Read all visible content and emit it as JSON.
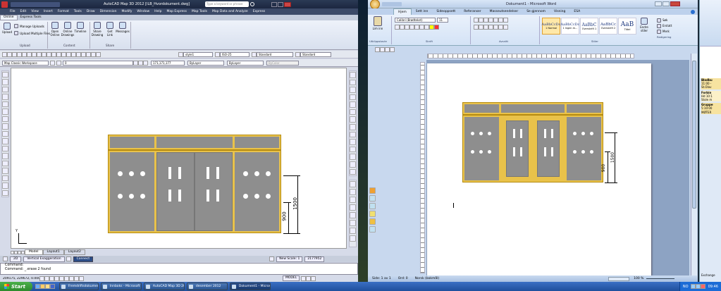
{
  "acad": {
    "title": "AutoCAD Map 3D 2012   [ILB_Hvordokument.dwg]",
    "search_placeholder": "Type a keyword or phrase",
    "menu": [
      "File",
      "Edit",
      "View",
      "Insert",
      "Format",
      "Tools",
      "Draw",
      "Dimension",
      "Modify",
      "Window",
      "Help",
      "Map Express",
      "Map Tools",
      "Map Data and Analyze",
      "Express"
    ],
    "ribbon_tabs": [
      "Online",
      "Express Tools"
    ],
    "upload_panel": {
      "upload": "Upload",
      "manage": "Manage Uploads",
      "multiple": "Upload Multiple Files",
      "label": "Upload"
    },
    "content_panel": {
      "open": "Open Online",
      "drawings": "Online Drawings",
      "timeline": "Timeline",
      "label": "Content"
    },
    "share_panel": {
      "share": "Share Drawing",
      "get_link": "Get Link",
      "messages": "Messages",
      "label": "Share"
    },
    "style_box": "style1",
    "dim_box": "ISO-25",
    "table_box": "Standard",
    "mleader_box": "Standard",
    "workspace": "Map Classic Workspace",
    "layer": "0",
    "color": "171,171,177",
    "linetype": "ByLayer",
    "lineweight": "ByLayer",
    "plotstyle": "ByColor",
    "dim_900": "900",
    "dim_1500": "1500",
    "layout_tabs": [
      "Model",
      "Layout1",
      "Layout2"
    ],
    "status_items": [
      "2D",
      "Vertical Exaggeration",
      "Connect"
    ],
    "status_right": [
      "New Scale: 1",
      "2177952",
      "MODEL"
    ],
    "cmd_lines": [
      "Command:",
      "Command:  _.erase 2 found"
    ],
    "coords": "209175, 229672, 0.0000",
    "axis_y": "Y"
  },
  "word": {
    "title": "Dokument1 - Microsoft Word",
    "tabs": [
      "Hjem",
      "Sett inn",
      "Sideoppsett",
      "Referanser",
      "Masseutsendelser",
      "Se gjennom",
      "Visning",
      "ESA"
    ],
    "clipboard": {
      "paste": "Lim inn",
      "label": "Utklippstavle"
    },
    "font_name": "Calibri (Brødtekst)",
    "font_size": "11",
    "font_label": "Skrift",
    "para_label": "Avsnitt",
    "styles_label": "Stiler",
    "edit_label": "Redigering",
    "styles": [
      {
        "sample": "AaBbCcDc",
        "name": "1 Normal"
      },
      {
        "sample": "AaBbCcDc",
        "name": "1 Ingen m..."
      },
      {
        "sample": "AaBbC",
        "name": "Overskrift 1"
      },
      {
        "sample": "AaBbCc",
        "name": "Overskrift 2"
      },
      {
        "sample": "AaB",
        "name": "Tittel"
      }
    ],
    "change_styles": "Endre stiler",
    "edit_items": [
      "Søk",
      "Erstatt",
      "Merk"
    ],
    "dim_900": "900",
    "dim_1500": "1500",
    "status": [
      "Side: 1 av 1",
      "Ord: 0",
      "Norsk (bokmål)"
    ],
    "zoom": "100 %"
  },
  "right_strip": {
    "items": [
      "Blodbu",
      "11:00 -",
      "St.Olav",
      "Forbin",
      "Hd 10:1",
      "Stole m",
      "Gruppe",
      "5:10:00",
      "MØTER"
    ],
    "bottom": "Exchange"
  },
  "taskbar": {
    "start": "Start",
    "windows": [
      "Fremdriftsdokument",
      "Innboks - Microsoft O...",
      "AutoCAD Map 3D 201...",
      "desember 2012",
      "Dokument1 - Microsof..."
    ],
    "lang": "NO",
    "clock": "09:46"
  }
}
